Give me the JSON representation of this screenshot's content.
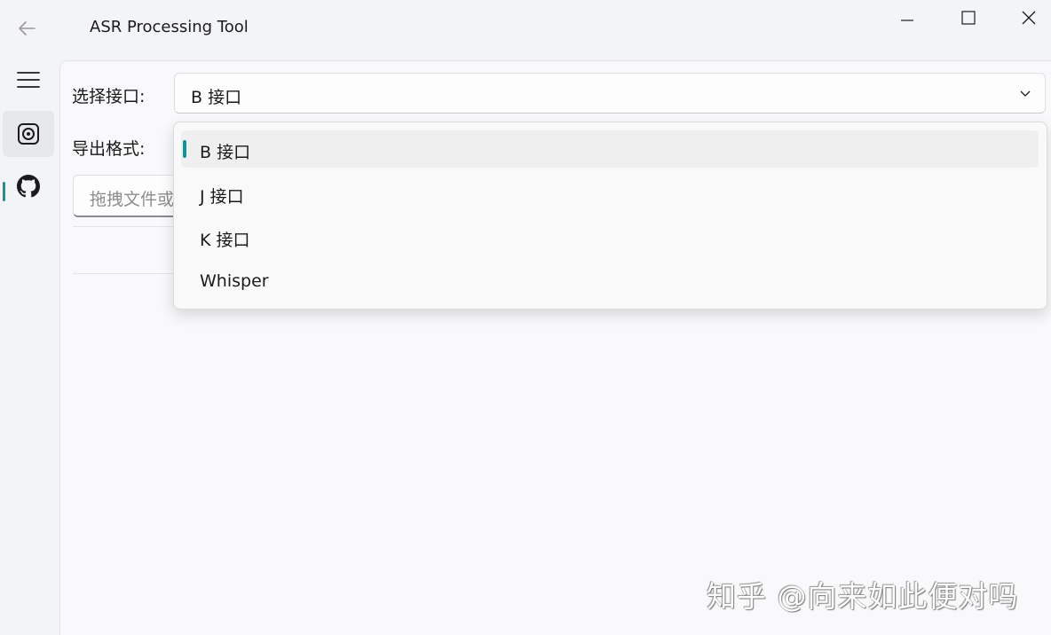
{
  "window": {
    "title": "ASR Processing Tool",
    "controls": [
      "minimize-icon",
      "maximize-icon",
      "close-icon"
    ]
  },
  "sidebar": {
    "items": [
      {
        "icon": "hamburger-menu-icon"
      },
      {
        "icon": "target-icon",
        "selected": true
      },
      {
        "icon": "github-icon"
      }
    ]
  },
  "form": {
    "interface_label": "选择接口:",
    "interface_value": "B 接口",
    "export_label": "导出格式:",
    "drop_placeholder": "拖拽文件或"
  },
  "dropdown": {
    "options": [
      "B 接口",
      "J 接口",
      "K 接口",
      "Whisper"
    ],
    "selected_index": 0
  },
  "watermark": "知乎 @向来如此便对吗",
  "colors": {
    "accent": "#10959c",
    "background": "#f3f4f7",
    "content_bg": "#f9f9fc"
  }
}
